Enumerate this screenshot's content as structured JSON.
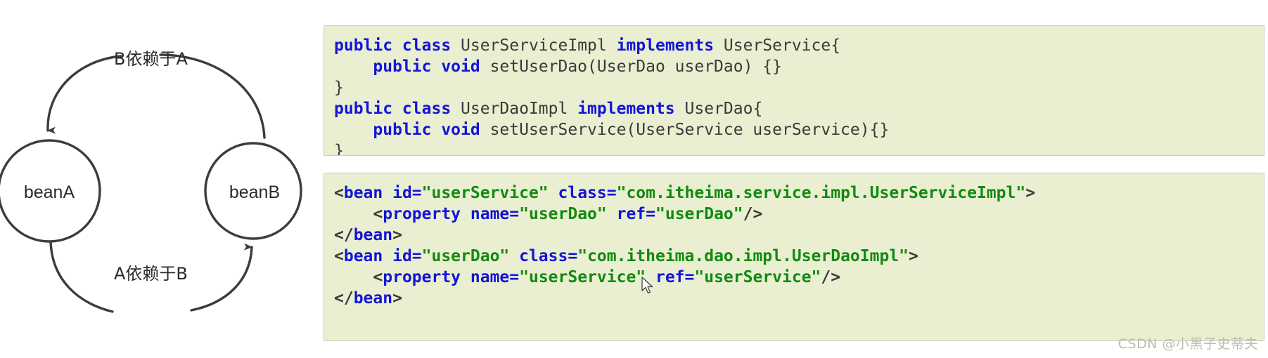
{
  "diagram": {
    "nodes": [
      {
        "id": "beanA",
        "label": "beanA"
      },
      {
        "id": "beanB",
        "label": "beanB"
      }
    ],
    "edges": [
      {
        "id": "b-depends-on-a",
        "label": "B依赖于A",
        "from": "beanB",
        "to": "beanA"
      },
      {
        "id": "a-depends-on-b",
        "label": "A依赖于B",
        "from": "beanA",
        "to": "beanB"
      }
    ],
    "stroke_color": "#3b3b42"
  },
  "java_block": {
    "background": "#e9efd0",
    "lines": [
      {
        "id": "java-line-1",
        "tokens": [
          {
            "text": "public class ",
            "type": "kw"
          },
          {
            "text": "UserServiceImpl ",
            "type": "plain"
          },
          {
            "text": "implements ",
            "type": "kw"
          },
          {
            "text": "UserService{",
            "type": "plain"
          }
        ]
      },
      {
        "id": "java-line-2",
        "tokens": [
          {
            "text": "    ",
            "type": "plain"
          },
          {
            "text": "public void ",
            "type": "kw"
          },
          {
            "text": "setUserDao(UserDao userDao) {}",
            "type": "plain"
          }
        ]
      },
      {
        "id": "java-line-3",
        "tokens": [
          {
            "text": "}",
            "type": "plain"
          }
        ]
      },
      {
        "id": "java-line-4",
        "tokens": [
          {
            "text": "public class ",
            "type": "kw"
          },
          {
            "text": "UserDaoImpl ",
            "type": "plain"
          },
          {
            "text": "implements ",
            "type": "kw"
          },
          {
            "text": "UserDao{",
            "type": "plain"
          }
        ]
      },
      {
        "id": "java-line-5",
        "tokens": [
          {
            "text": "    ",
            "type": "plain"
          },
          {
            "text": "public void ",
            "type": "kw"
          },
          {
            "text": "setUserService(UserService userService){}",
            "type": "plain"
          }
        ]
      },
      {
        "id": "java-line-6",
        "tokens": [
          {
            "text": "}",
            "type": "plain"
          }
        ]
      }
    ]
  },
  "xml_block": {
    "background": "#e9efd0",
    "lines": [
      {
        "id": "xml-line-1",
        "tokens": [
          {
            "text": "<",
            "type": "punct"
          },
          {
            "text": "bean id=",
            "type": "tag"
          },
          {
            "text": "\"userService\"",
            "type": "str"
          },
          {
            "text": " class=",
            "type": "tag"
          },
          {
            "text": "\"com.itheima.service.impl.UserServiceImpl\"",
            "type": "str"
          },
          {
            "text": ">",
            "type": "punct"
          }
        ]
      },
      {
        "id": "xml-line-2",
        "tokens": [
          {
            "text": "    <",
            "type": "punct"
          },
          {
            "text": "property name=",
            "type": "tag"
          },
          {
            "text": "\"userDao\"",
            "type": "str"
          },
          {
            "text": " ref=",
            "type": "tag"
          },
          {
            "text": "\"userDao\"",
            "type": "str"
          },
          {
            "text": "/>",
            "type": "punct"
          }
        ]
      },
      {
        "id": "xml-line-3",
        "tokens": [
          {
            "text": "</",
            "type": "punct"
          },
          {
            "text": "bean",
            "type": "tag"
          },
          {
            "text": ">",
            "type": "punct"
          }
        ]
      },
      {
        "id": "xml-line-4",
        "tokens": [
          {
            "text": "<",
            "type": "punct"
          },
          {
            "text": "bean id=",
            "type": "tag"
          },
          {
            "text": "\"userDao\"",
            "type": "str"
          },
          {
            "text": " class=",
            "type": "tag"
          },
          {
            "text": "\"com.itheima.dao.impl.UserDaoImpl\"",
            "type": "str"
          },
          {
            "text": ">",
            "type": "punct"
          }
        ]
      },
      {
        "id": "xml-line-5",
        "tokens": [
          {
            "text": "    <",
            "type": "punct"
          },
          {
            "text": "property name=",
            "type": "tag"
          },
          {
            "text": "\"userService\"",
            "type": "str"
          },
          {
            "text": " ref=",
            "type": "tag"
          },
          {
            "text": "\"userService\"",
            "type": "str"
          },
          {
            "text": "/>",
            "type": "punct"
          }
        ]
      },
      {
        "id": "xml-line-6",
        "tokens": [
          {
            "text": "</",
            "type": "punct"
          },
          {
            "text": "bean",
            "type": "tag"
          },
          {
            "text": ">",
            "type": "punct"
          }
        ]
      }
    ]
  },
  "watermark": {
    "text": "CSDN @小黑子史蒂夫"
  }
}
